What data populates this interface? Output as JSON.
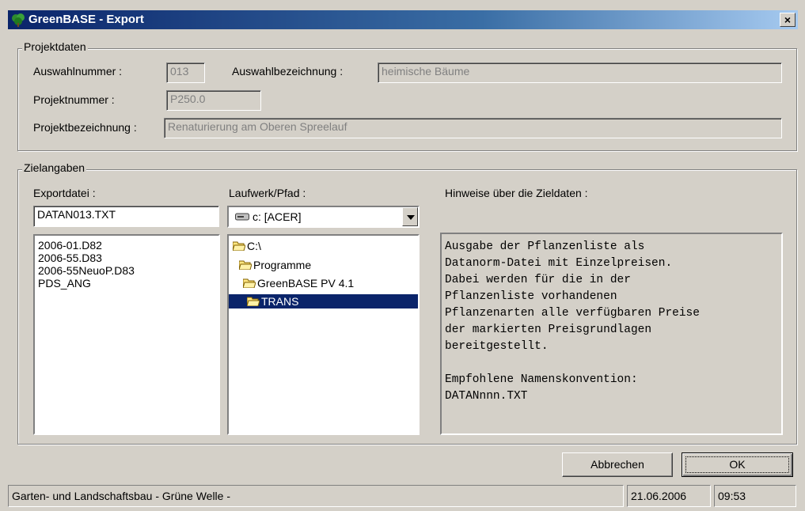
{
  "window": {
    "title": "GreenBASE - Export",
    "close_label": "×"
  },
  "projektdaten": {
    "legend": "Projektdaten",
    "auswahlnummer_label": "Auswahlnummer :",
    "auswahlnummer_value": "013",
    "auswahlbezeichnung_label": "Auswahlbezeichnung :",
    "auswahlbezeichnung_value": "heimische Bäume",
    "projektnummer_label": "Projektnummer :",
    "projektnummer_value": "P250.0",
    "projektbezeichnung_label": "Projektbezeichnung :",
    "projektbezeichnung_value": "Renaturierung am Oberen Spreelauf"
  },
  "zielangaben": {
    "legend": "Zielangaben",
    "exportdatei_label": "Exportdatei :",
    "exportdatei_value": "DATAN013.TXT",
    "files": [
      "2006-01.D82",
      "2006-55.D83",
      "2006-55NeuoP.D83",
      "PDS_ANG"
    ],
    "laufwerk_label": "Laufwerk/Pfad :",
    "drive_value": "c: [ACER]",
    "folders": [
      "C:\\",
      "Programme",
      "GreenBASE PV 4.1",
      "TRANS"
    ],
    "hinweise_label": "Hinweise über die Zieldaten :",
    "hinweise_text": "Ausgabe der Pflanzenliste als\nDatanorm-Datei mit Einzelpreisen.\nDabei werden für die in der\nPflanzenliste vorhandenen\nPflanzenarten alle verfügbaren Preise\nder markierten Preisgrundlagen\nbereitgestellt.\n\nEmpfohlene Namenskonvention:\nDATANnnn.TXT"
  },
  "buttons": {
    "cancel": "Abbrechen",
    "ok": "OK"
  },
  "statusbar": {
    "text": "Garten- und Landschaftsbau  - Grüne Welle -",
    "date": "21.06.2006",
    "time": "09:53"
  },
  "colors": {
    "titlebar": "#0a246a",
    "selection": "#0a246a",
    "face": "#d4d0c8"
  }
}
